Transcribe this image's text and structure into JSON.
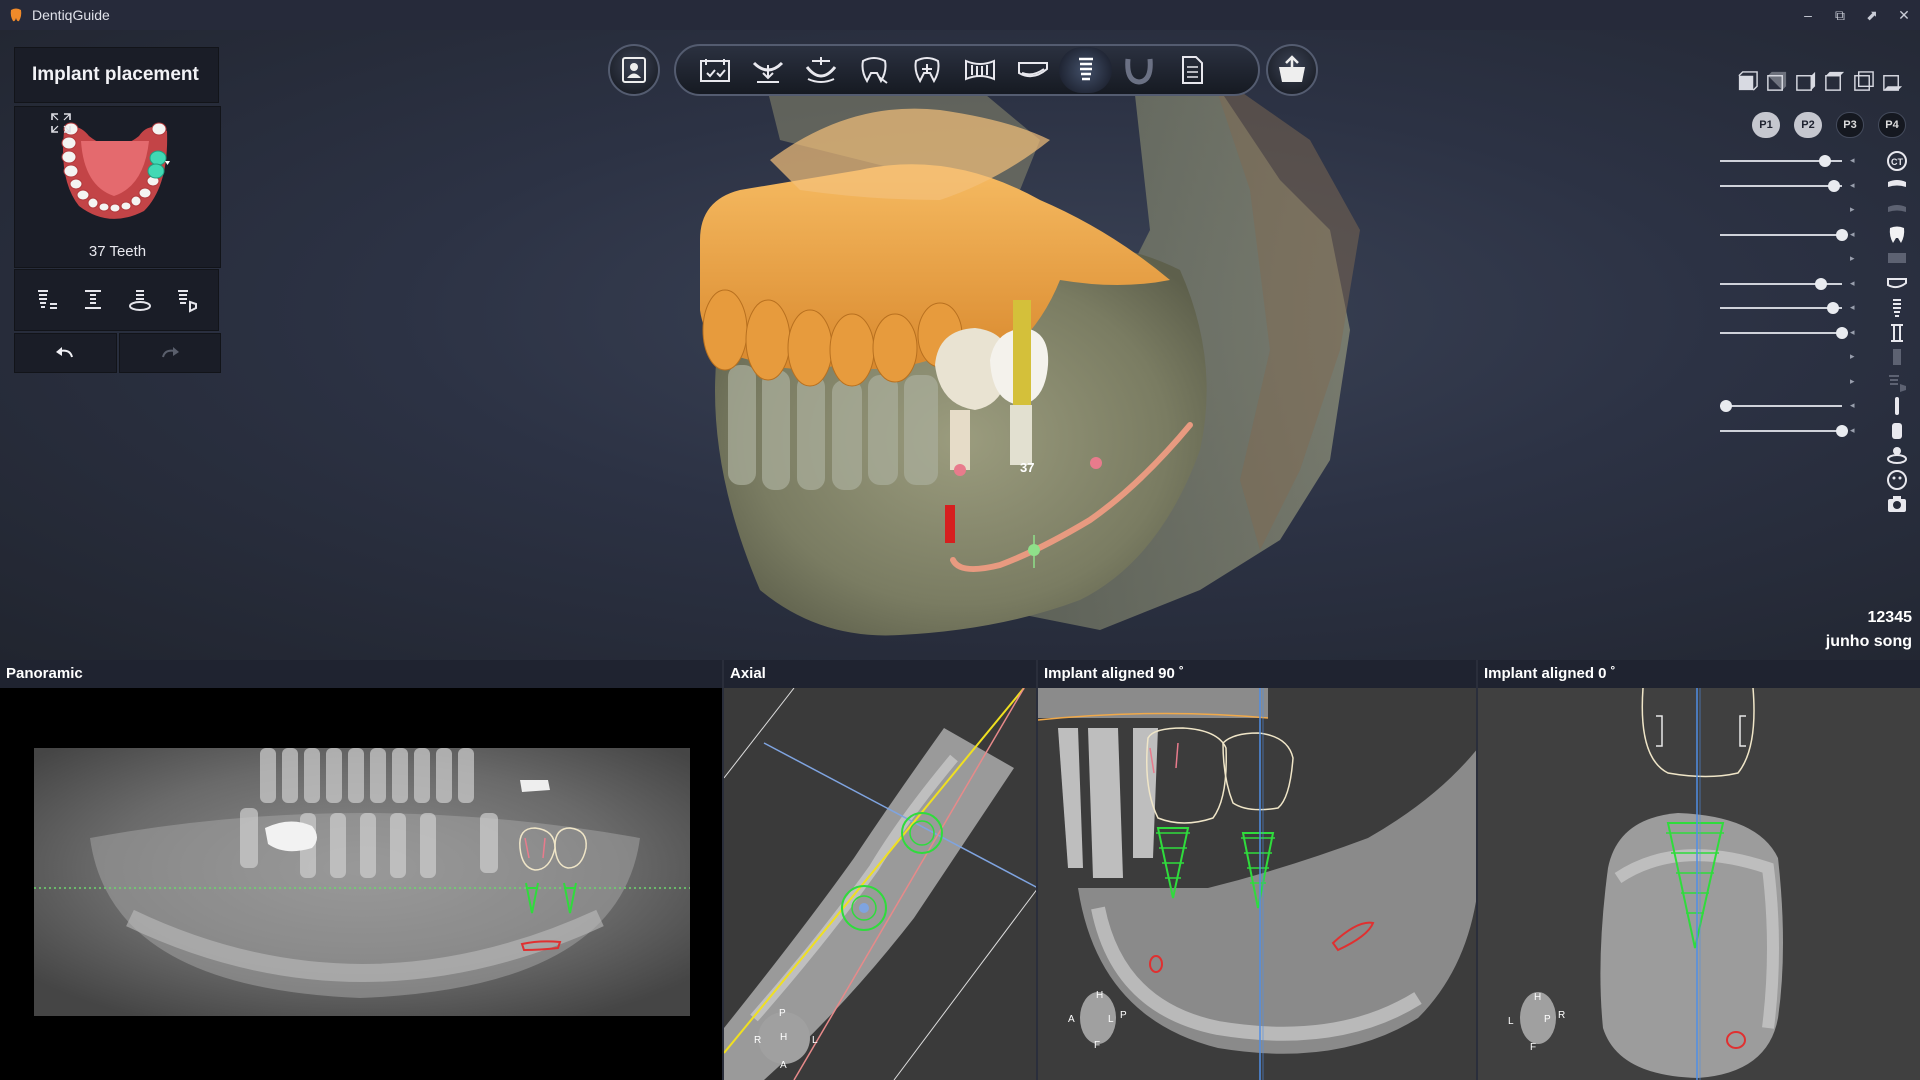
{
  "app": {
    "title": "DentiqGuide"
  },
  "window_controls": [
    "–",
    "⧉",
    "⬈",
    "✕"
  ],
  "left_panel": {
    "mode_title": "Implant placement",
    "teeth_label": "37 Teeth",
    "tool_icons": [
      "implant-list-icon",
      "implant-center-icon",
      "implant-rotate-icon",
      "implant-check-icon"
    ],
    "undo_icon": "undo-icon",
    "redo_icon": "redo-icon"
  },
  "toolbar": {
    "left_icon": "patient-info-icon",
    "right_icon": "export-icon",
    "active_index": 7,
    "icons": [
      "scan-data-icon",
      "jaw-align-icon",
      "arch-icon",
      "tooth-segment-icon",
      "tooth-add-icon",
      "panoramic-icon",
      "nerve-icon",
      "implant-icon",
      "guide-icon",
      "report-icon"
    ]
  },
  "right_panel": {
    "presets": [
      "P1",
      "P2",
      "P3",
      "P4"
    ],
    "layers": [
      {
        "icon": "ct-icon",
        "slider": 0.85,
        "label": "CT"
      },
      {
        "icon": "maxilla-scan-icon",
        "slider": 0.93
      },
      {
        "icon": "upper-teeth-icon",
        "slider": null
      },
      {
        "icon": "tooth-icon",
        "slider": 1.0
      },
      {
        "icon": "lower-scan-icon",
        "slider": null
      },
      {
        "icon": "nerve-layer-icon",
        "slider": 0.82
      },
      {
        "icon": "implant-layer-icon",
        "slider": 0.92
      },
      {
        "icon": "abutment-icon",
        "slider": 1.0
      },
      {
        "icon": "sleeve-icon",
        "slider": null
      },
      {
        "icon": "guide-layer-icon",
        "slider": null
      },
      {
        "icon": "drill-icon",
        "slider": 0.0
      },
      {
        "icon": "cylinder-icon",
        "slider": 1.0
      },
      {
        "icon": "person-view-icon",
        "slider": null
      },
      {
        "icon": "face-icon",
        "slider": null
      },
      {
        "icon": "camera-icon",
        "slider": null
      }
    ]
  },
  "patient": {
    "id": "12345",
    "name": "junho song"
  },
  "scene": {
    "tooth_label": "37"
  },
  "views": {
    "panoramic": {
      "title": "Panoramic"
    },
    "axial": {
      "title": "Axial",
      "orient": {
        "top": "P",
        "center": "H",
        "left": "R",
        "right": "L",
        "bottom": "A"
      }
    },
    "aligned90": {
      "title": "Implant aligned 90 ˚",
      "orient": {
        "top": "H",
        "left": "A",
        "mid": "L",
        "right": "P",
        "bottom": "F"
      }
    },
    "aligned0": {
      "title": "Implant aligned 0 ˚",
      "orient": {
        "top": "H",
        "left": "L",
        "mid": "P",
        "right": "R",
        "bottom": "F"
      }
    }
  },
  "colors": {
    "bone": "#8a8d6e",
    "crown": "#f0a94a",
    "implant_outline": "#2fdc3c",
    "nerve": "#e03030",
    "toolbar_border": "#545c70"
  }
}
